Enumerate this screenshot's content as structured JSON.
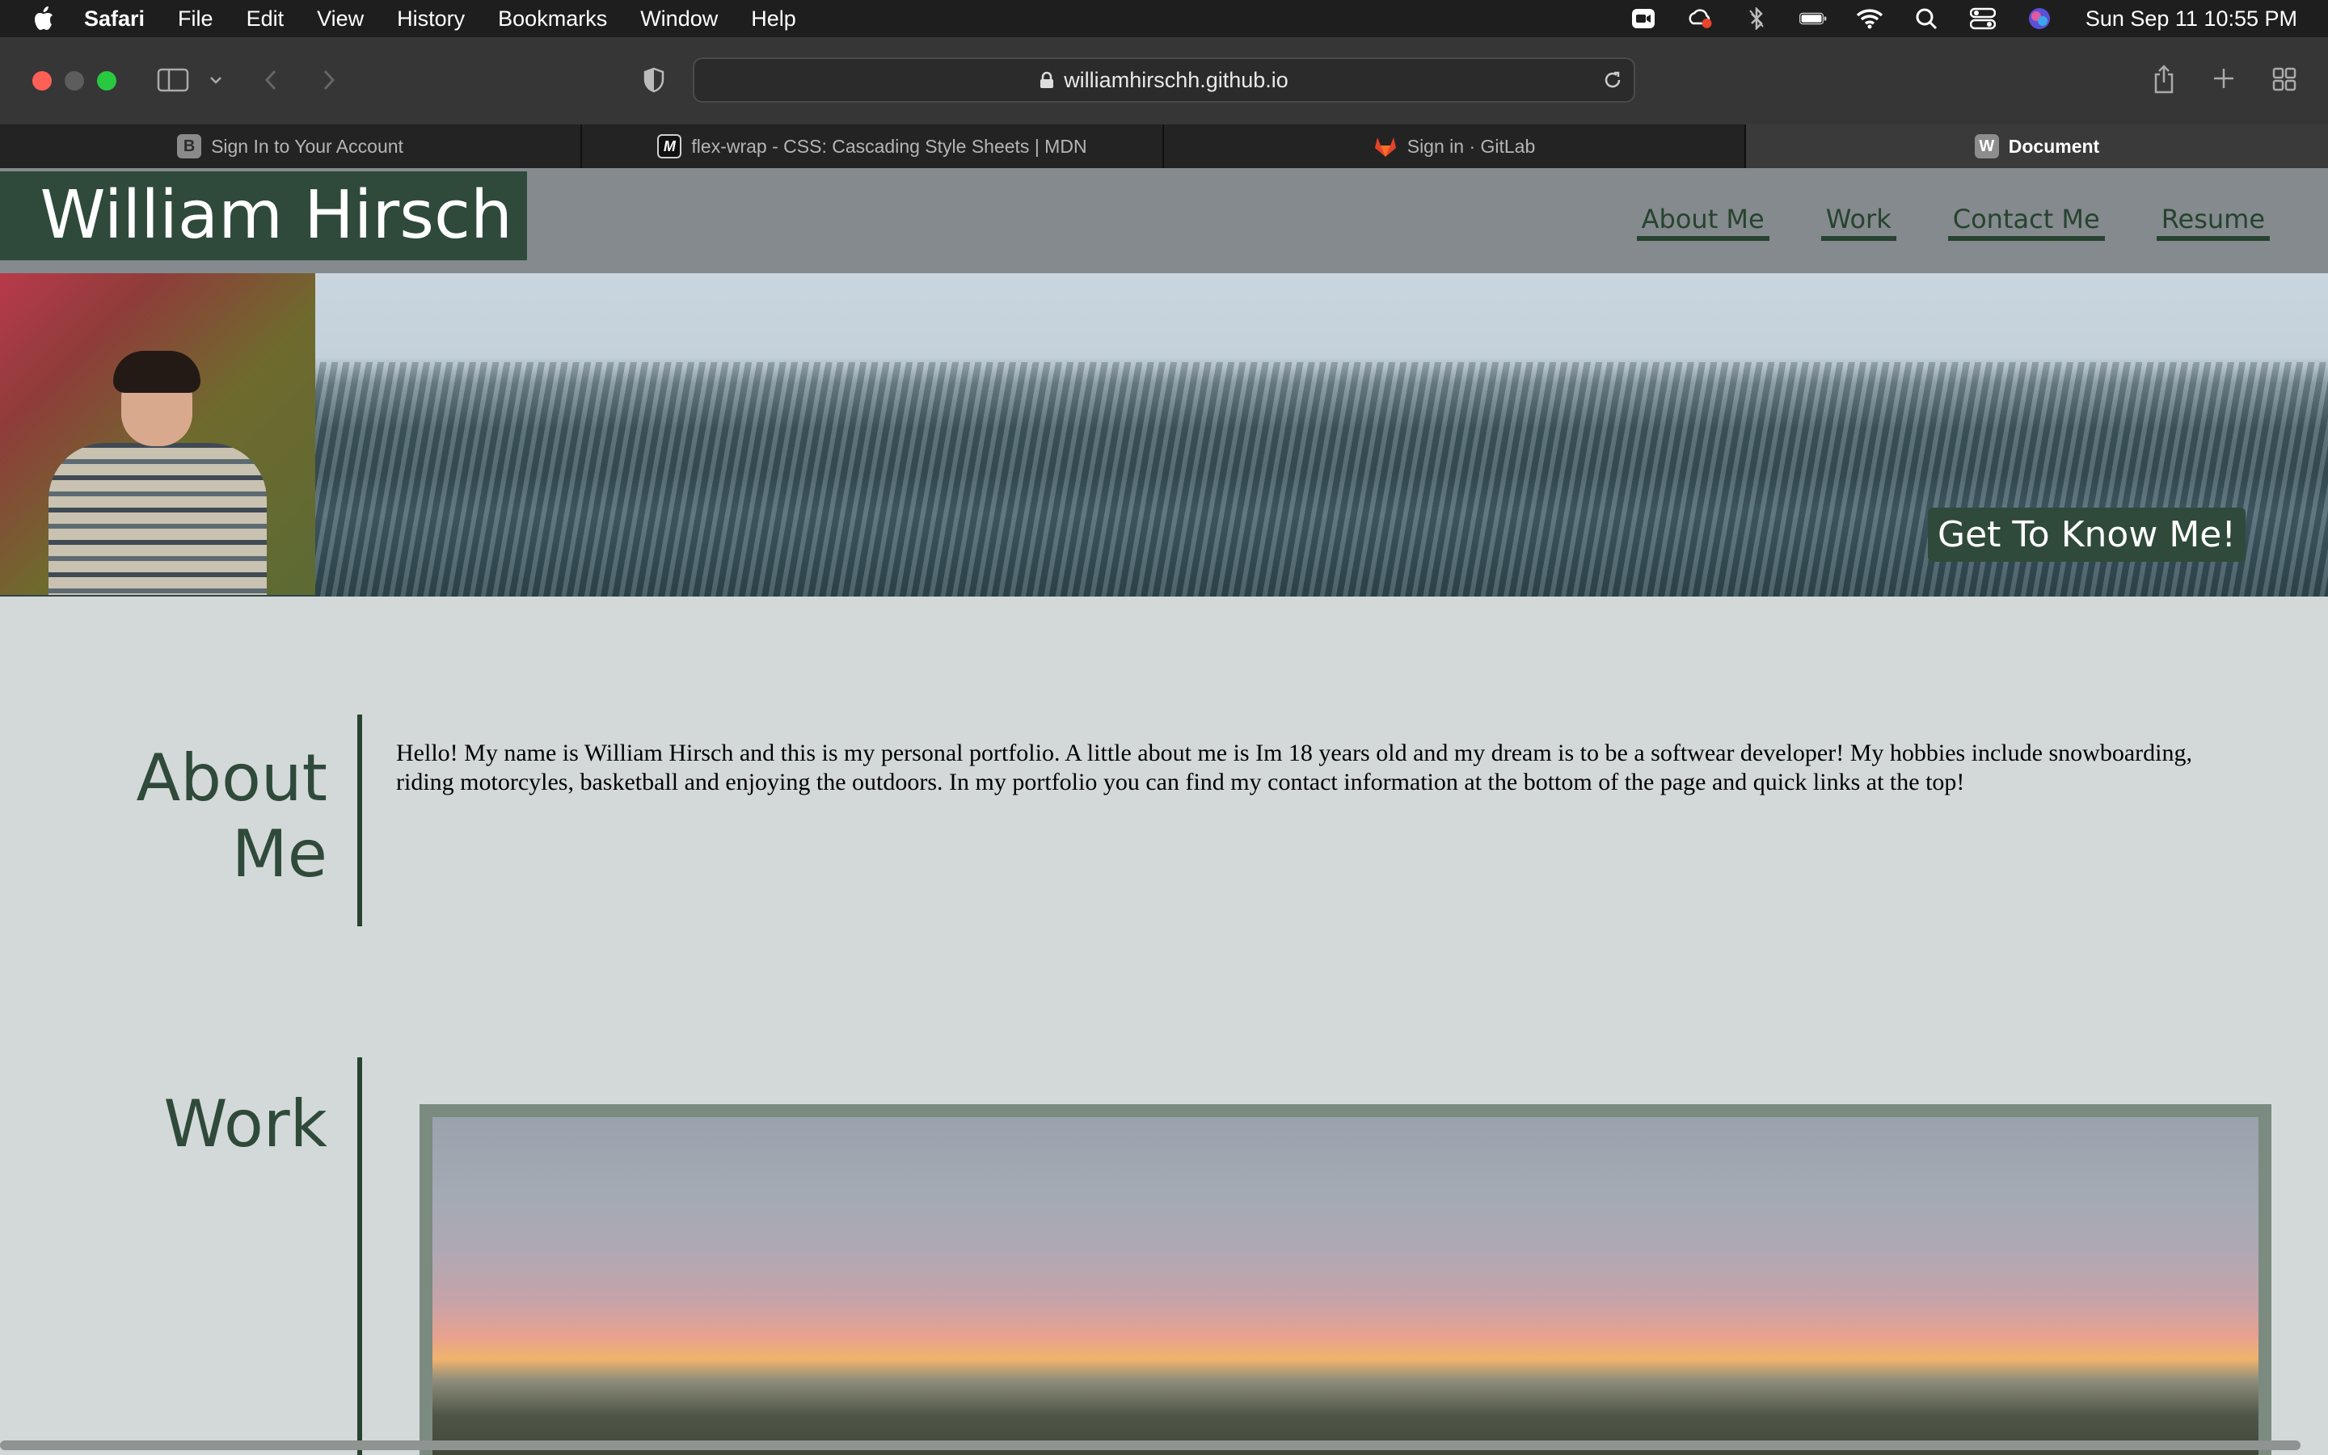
{
  "menubar": {
    "app_name": "Safari",
    "items": [
      "File",
      "Edit",
      "View",
      "History",
      "Bookmarks",
      "Window",
      "Help"
    ],
    "status_icons": [
      "zoom-icon",
      "creative-cloud-icon",
      "bluetooth-icon",
      "battery-icon",
      "wifi-icon",
      "spotlight-icon",
      "control-center-icon",
      "siri-icon"
    ],
    "clock": "Sun Sep 11  10:55 PM"
  },
  "browser": {
    "url": "williamhirschh.github.io",
    "tabs": [
      {
        "favicon": "B",
        "label": "Sign In to Your Account",
        "active": false
      },
      {
        "favicon": "M",
        "label": "flex-wrap - CSS: Cascading Style Sheets | MDN",
        "active": false
      },
      {
        "favicon": "gitlab",
        "label": "Sign in · GitLab",
        "active": false
      },
      {
        "favicon": "W",
        "label": "Document",
        "active": true
      }
    ]
  },
  "site": {
    "name": "William Hirsch",
    "nav": [
      "About Me",
      "Work",
      "Contact Me",
      "Resume"
    ],
    "hero_cta": "Get To Know Me!",
    "about": {
      "title": "About Me",
      "text": "Hello! My name is William Hirsch and this is my personal portfolio. A little about me is Im 18 years old and my dream is to be a softwear developer! My hobbies include snowboarding, riding motorcyles, basketball and enjoying the outdoors. In my portfolio you can find my contact information at the bottom of the page and quick links at the top!"
    },
    "work": {
      "title": "Work"
    }
  },
  "colors": {
    "brand_green": "#2f4a3a",
    "header_gray": "#858a8e",
    "page_bg": "#d3d9d8"
  }
}
